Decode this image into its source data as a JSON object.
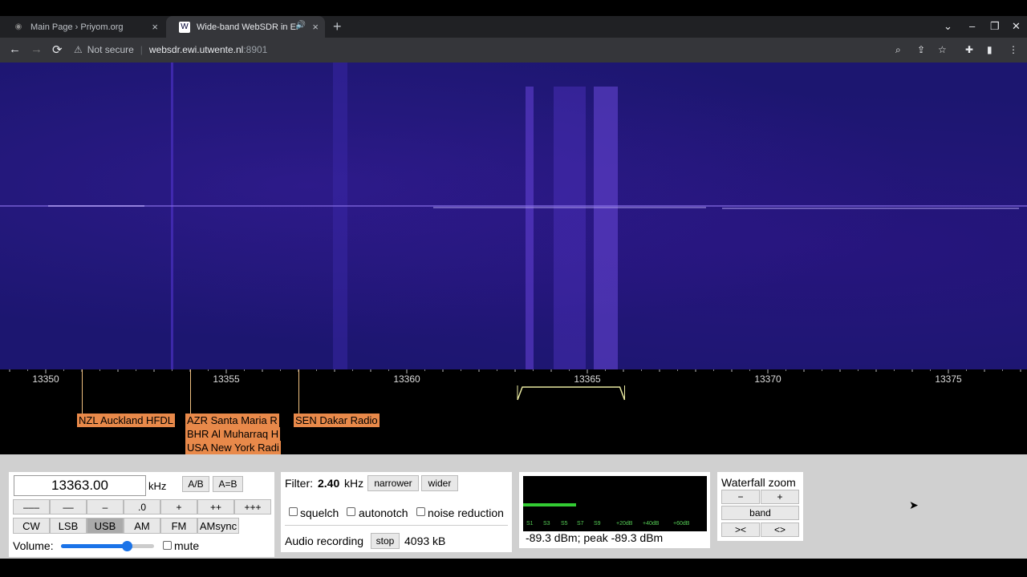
{
  "tabs": [
    {
      "title": "Main Page › Priyom.org",
      "close": "×"
    },
    {
      "title": "Wide-band WebSDR in Enschede",
      "close": "×",
      "audio": "🔊"
    }
  ],
  "new_tab": "+",
  "window_controls": {
    "dropdown": "⌄",
    "minimize": "–",
    "restore": "❐",
    "close": "✕"
  },
  "nav": {
    "back": "←",
    "forward": "→",
    "reload": "⟳"
  },
  "address": {
    "security": "Not secure",
    "host": "websdr.ewi.utwente.nl",
    "port": ":8901"
  },
  "toolbar_icons": {
    "zoom": "⌕",
    "share": "⇪",
    "star": "☆",
    "extensions": "✚",
    "sidepanel": "▮",
    "menu": "⋮"
  },
  "scale": {
    "ticks": [
      {
        "label": "13350",
        "value": 13350
      },
      {
        "label": "13355",
        "value": 13355
      },
      {
        "label": "13360",
        "value": 13360
      },
      {
        "label": "13365",
        "value": 13365
      },
      {
        "label": "13370",
        "value": 13370
      },
      {
        "label": "13375",
        "value": 13375
      }
    ],
    "tuned_khz": 13363.0,
    "passband_khz": [
      13363.2,
      13365.9
    ]
  },
  "stations": [
    {
      "name": "NZL Auckland HFDL",
      "khz": 13351.0
    },
    {
      "name": "AZR Santa Maria R",
      "khz": 13354.0
    },
    {
      "name": "BHR Al Muharraq H",
      "khz": 13354.0
    },
    {
      "name": "USA New York Radi",
      "khz": 13354.0
    },
    {
      "name": "SEN Dakar Radio",
      "khz": 13357.0
    }
  ],
  "freq": {
    "value": "13363.00",
    "unit": "kHz",
    "ab": "A/B",
    "a_eq_b": "A=B"
  },
  "step_buttons": [
    "–––",
    "––",
    "–",
    ".0",
    "+",
    "++",
    "+++"
  ],
  "modes": [
    "CW",
    "LSB",
    "USB",
    "AM",
    "FM",
    "AMsync"
  ],
  "active_mode": "USB",
  "volume": {
    "label": "Volume:",
    "level": 0.71,
    "mute": "mute"
  },
  "filter": {
    "label": "Filter:",
    "value": "2.40",
    "unit": "kHz",
    "narrower": "narrower",
    "wider": "wider"
  },
  "options": {
    "squelch": "squelch",
    "autonotch": "autonotch",
    "noise": "noise reduction"
  },
  "recording": {
    "label": "Audio recording",
    "stop": "stop",
    "size": "4093 kB"
  },
  "smeter": {
    "labels": [
      "S1",
      "S3",
      "S5",
      "S7",
      "S9",
      "+20dB",
      "+40dB",
      "+60dB"
    ],
    "level": 0.29,
    "readout": "-89.3 dBm; peak  -89.3 dBm"
  },
  "zoom": {
    "title": "Waterfall zoom",
    "minus": "−",
    "plus": "+",
    "band": "band",
    "narrow": "><",
    "wide": "<>"
  },
  "colors": {
    "waterfall": "#1c1670",
    "station": "#e8894a",
    "passband": "#e8e8a0",
    "meter": "#33cc33"
  }
}
